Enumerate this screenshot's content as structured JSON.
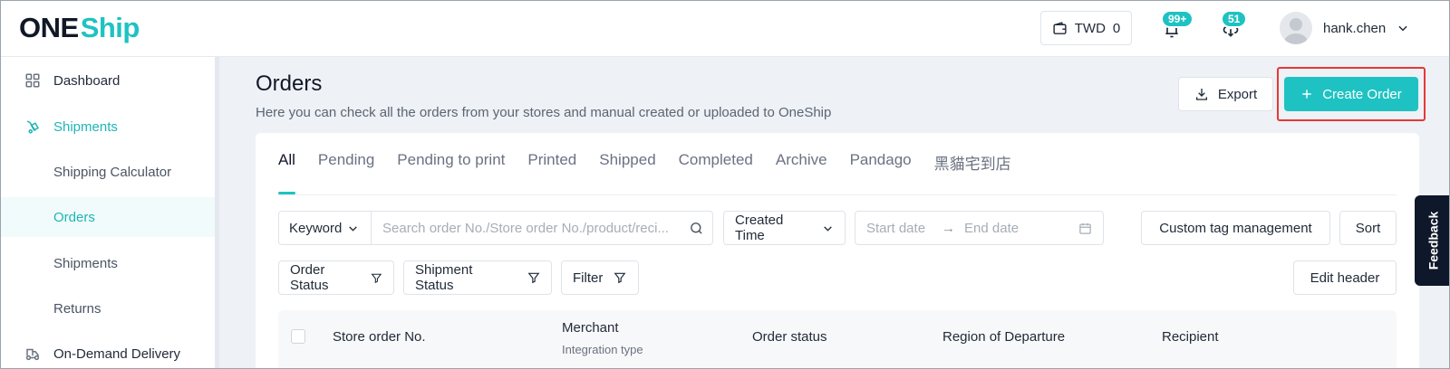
{
  "brand": {
    "one": "ONE",
    "ship": "Ship",
    "accent": "#1fc2c2"
  },
  "header": {
    "wallet": {
      "currency": "TWD",
      "amount": "0",
      "icon": "wallet-icon"
    },
    "notifications": {
      "badge": "99+",
      "icon": "bell-icon"
    },
    "downloads": {
      "badge": "51",
      "icon": "download-icon"
    },
    "user": {
      "name": "hank.chen",
      "icon": "chevron-down-icon"
    }
  },
  "sidebar": {
    "items": [
      {
        "label": "Dashboard",
        "icon": "dashboard-icon"
      },
      {
        "label": "Shipments",
        "icon": "shipments-icon"
      },
      {
        "label": "Shipping Calculator"
      },
      {
        "label": "Orders"
      },
      {
        "label": "Shipments"
      },
      {
        "label": "Returns"
      },
      {
        "label": "On-Demand Delivery",
        "icon": "delivery-icon"
      }
    ]
  },
  "main": {
    "title": "Orders",
    "description": "Here you can check all the orders from your stores and manual created or uploaded to OneShip",
    "export_label": "Export",
    "create_label": "Create Order",
    "tabs": [
      {
        "label": "All"
      },
      {
        "label": "Pending"
      },
      {
        "label": "Pending to print"
      },
      {
        "label": "Printed"
      },
      {
        "label": "Shipped"
      },
      {
        "label": "Completed"
      },
      {
        "label": "Archive"
      },
      {
        "label": "Pandago"
      },
      {
        "label": "黑貓宅到店"
      }
    ],
    "filters": {
      "keyword_label": "Keyword",
      "search_placeholder": "Search order No./Store order No./product/reci...",
      "time_label": "Created Time",
      "start_placeholder": "Start date",
      "end_placeholder": "End date",
      "custom_tag_label": "Custom tag management",
      "sort_label": "Sort",
      "order_status_label": "Order Status",
      "shipment_status_label": "Shipment Status",
      "filter_label": "Filter",
      "edit_header_label": "Edit header"
    },
    "table": {
      "columns": [
        {
          "label": "Store order No."
        },
        {
          "label": "Merchant",
          "sub": "Integration type"
        },
        {
          "label": "Order status"
        },
        {
          "label": "Region of Departure"
        },
        {
          "label": "Recipient"
        }
      ]
    }
  },
  "feedback_label": "Feedback"
}
